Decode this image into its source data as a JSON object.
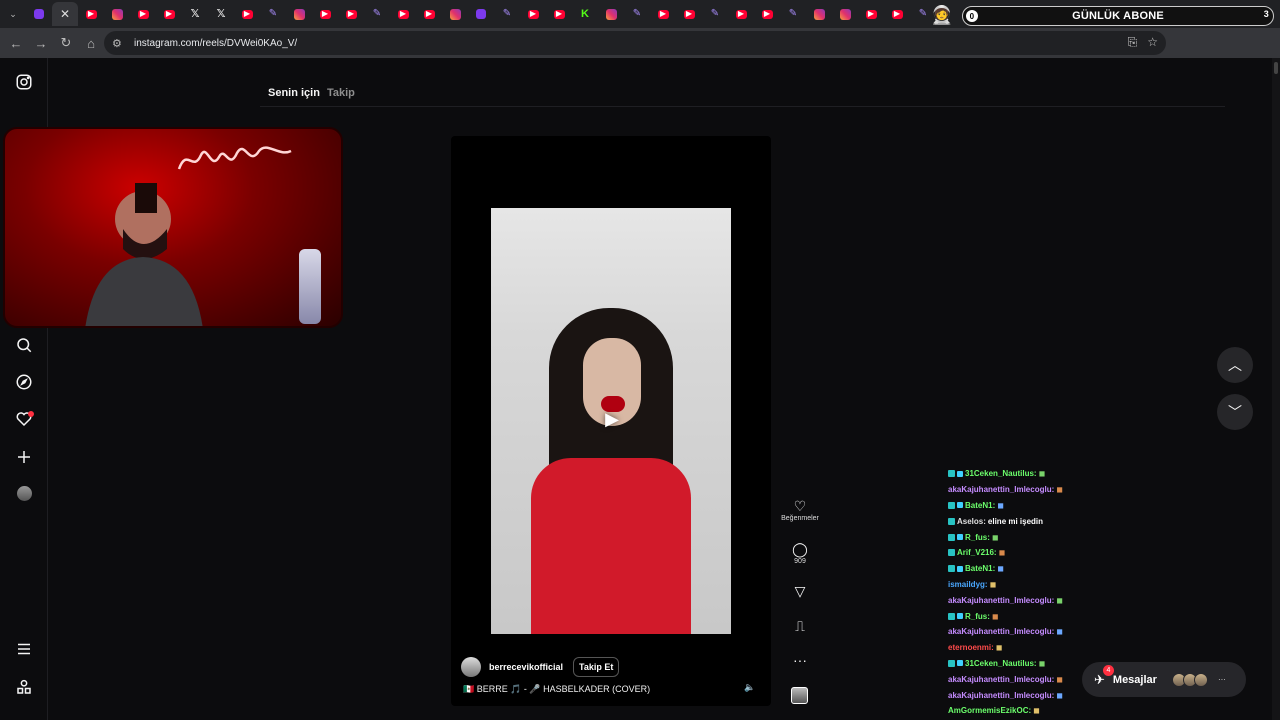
{
  "browser": {
    "url": "instagram.com/reels/DVWei0KAo_V/",
    "tabs": [
      "gen",
      "cls",
      "yt",
      "ig",
      "yt",
      "yt",
      "x",
      "x",
      "yt",
      "feather",
      "ig",
      "yt",
      "yt",
      "feather",
      "yt",
      "yt",
      "ig",
      "gen",
      "feather",
      "yt",
      "yt",
      "kick",
      "ig",
      "feather",
      "yt",
      "yt",
      "feather",
      "yt",
      "yt",
      "feather",
      "ig",
      "ig",
      "yt",
      "yt",
      "feather"
    ],
    "banner": {
      "title": "GÜNLÜK ABONE",
      "left_badge": "0",
      "right_badge": "3"
    }
  },
  "feed_tabs": {
    "for_you": "Senin için",
    "following": "Takip"
  },
  "reel": {
    "author": "berrecevikofficial",
    "follow_label": "Takip Et",
    "caption": "🇲🇽 BERRE 🎵 - 🎤 HASBELKADER (COVER)",
    "likes_label": "Beğenmeler",
    "comments_count": "909"
  },
  "chat": [
    {
      "user": "31Ceken_Nautilus:",
      "color": "#6cff6c",
      "text": "",
      "badges": 2,
      "emote": true
    },
    {
      "user": "akaKajuhanettin_Imlecoglu:",
      "color": "#c58cff",
      "text": "",
      "badges": 0,
      "emote": true
    },
    {
      "user": "BateN1:",
      "color": "#6cff6c",
      "text": "",
      "badges": 2,
      "emote": true
    },
    {
      "user": "Aselos:",
      "color": "#e0e0e0",
      "text": "eline mi işedin",
      "badges": 1,
      "emote": false
    },
    {
      "user": "R_fus:",
      "color": "#6cff6c",
      "text": "",
      "badges": 2,
      "emote": true
    },
    {
      "user": "Arif_V216:",
      "color": "#6cff6c",
      "text": "",
      "badges": 1,
      "emote": true
    },
    {
      "user": "BateN1:",
      "color": "#6cff6c",
      "text": "",
      "badges": 2,
      "emote": true
    },
    {
      "user": "ismaildyg:",
      "color": "#4aa8ff",
      "text": "",
      "badges": 0,
      "emote": true
    },
    {
      "user": "akaKajuhanettin_Imlecoglu:",
      "color": "#c58cff",
      "text": "",
      "badges": 0,
      "emote": true
    },
    {
      "user": "R_fus:",
      "color": "#6cff6c",
      "text": "",
      "badges": 2,
      "emote": true
    },
    {
      "user": "akaKajuhanettin_Imlecoglu:",
      "color": "#c58cff",
      "text": "",
      "badges": 0,
      "emote": true
    },
    {
      "user": "eternoenmi:",
      "color": "#ff4b4b",
      "text": "",
      "badges": 0,
      "emote": true
    },
    {
      "user": "31Ceken_Nautilus:",
      "color": "#6cff6c",
      "text": "",
      "badges": 2,
      "emote": true
    },
    {
      "user": "akaKajuhanettin_Imlecoglu:",
      "color": "#c58cff",
      "text": "",
      "badges": 0,
      "emote": true
    },
    {
      "user": "akaKajuhanettin_Imlecoglu:",
      "color": "#c58cff",
      "text": "",
      "badges": 0,
      "emote": true
    },
    {
      "user": "AmGormemisEzikOC:",
      "color": "#6cff6c",
      "text": "",
      "badges": 0,
      "emote": true
    }
  ],
  "messages": {
    "label": "Mesajlar",
    "unread": "4"
  }
}
